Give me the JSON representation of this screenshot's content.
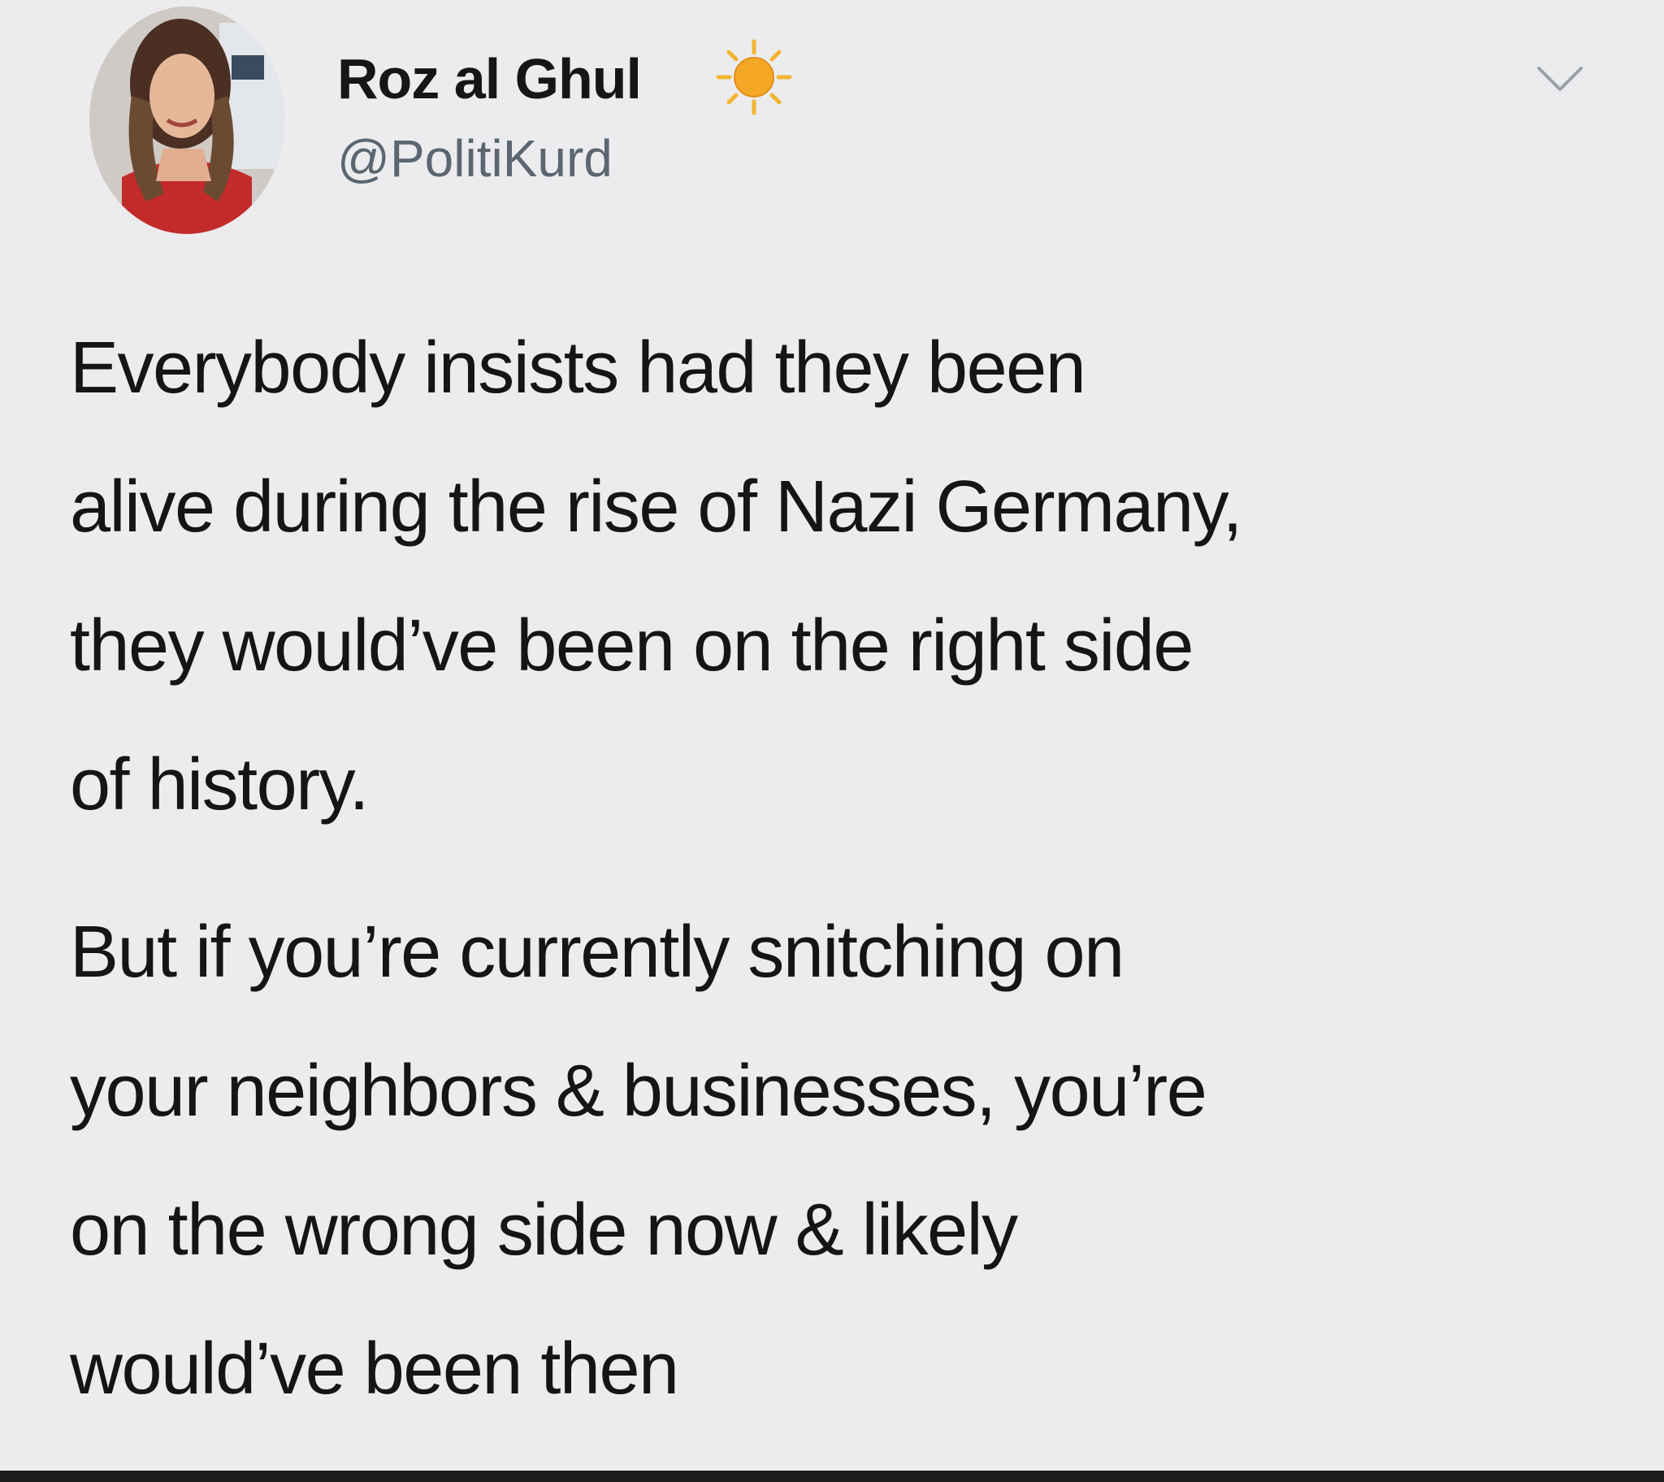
{
  "tweet": {
    "author": {
      "display_name": "Roz al Ghul",
      "handle": "@PolitiKurd",
      "badge_icon": "sun-icon",
      "avatar_icon": "profile-photo"
    },
    "menu_icon": "chevron-down-icon",
    "paragraphs": [
      "Everybody insists had they been\nalive during the rise of Nazi Germany,\nthey would’ve been on the right side\nof history.",
      "But if you’re currently snitching on\nyour neighbors & businesses, you’re\non the wrong side now & likely\nwould’ve been then"
    ]
  },
  "colors": {
    "background": "#ececee",
    "text": "#151515",
    "handle": "#5b6670",
    "sun": "#f4a826",
    "bottom_bar": "#1c1c1e"
  }
}
